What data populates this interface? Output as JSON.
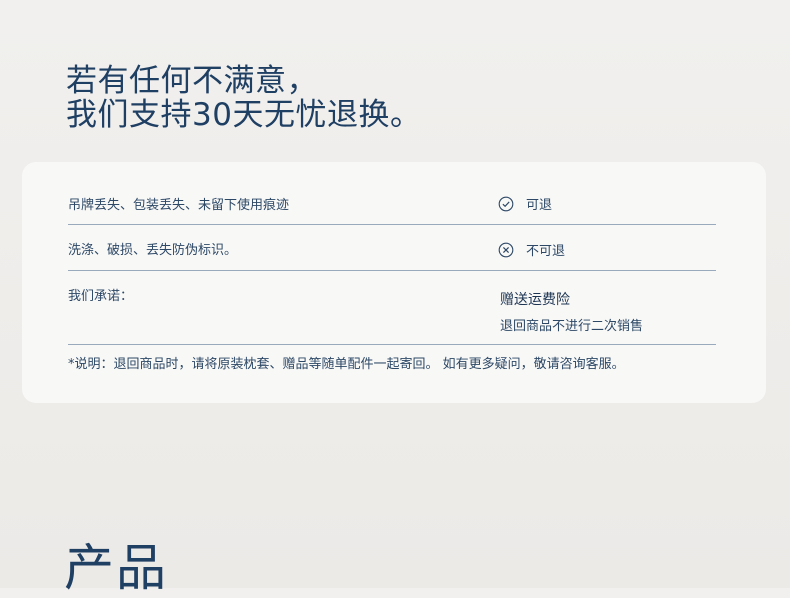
{
  "headline": {
    "line1": "若有任何不满意，",
    "line2": "我们支持30天无忧退换。"
  },
  "policy": {
    "rows": [
      {
        "label": "吊牌丢失、包装丢失、未留下使用痕迹",
        "status": "可退",
        "icon": "check-circle-icon"
      },
      {
        "label": "洗涤、破损、丢失防伪标识。",
        "status": "不可退",
        "icon": "x-circle-icon"
      }
    ],
    "promise": {
      "label": "我们承诺：",
      "title": "赠送运费险",
      "subtitle": "退回商品不进行二次销售"
    },
    "note": "*说明：退回商品时，请将原装枕套、赠品等随单配件一起寄回。 如有更多疑问，敬请咨询客服。"
  },
  "section": {
    "title": "产品"
  },
  "colors": {
    "background": "#eeedeb",
    "card": "#f8f8f7",
    "heading": "#1f3f63",
    "text": "#2d4866",
    "divider": "#9aaabd"
  }
}
